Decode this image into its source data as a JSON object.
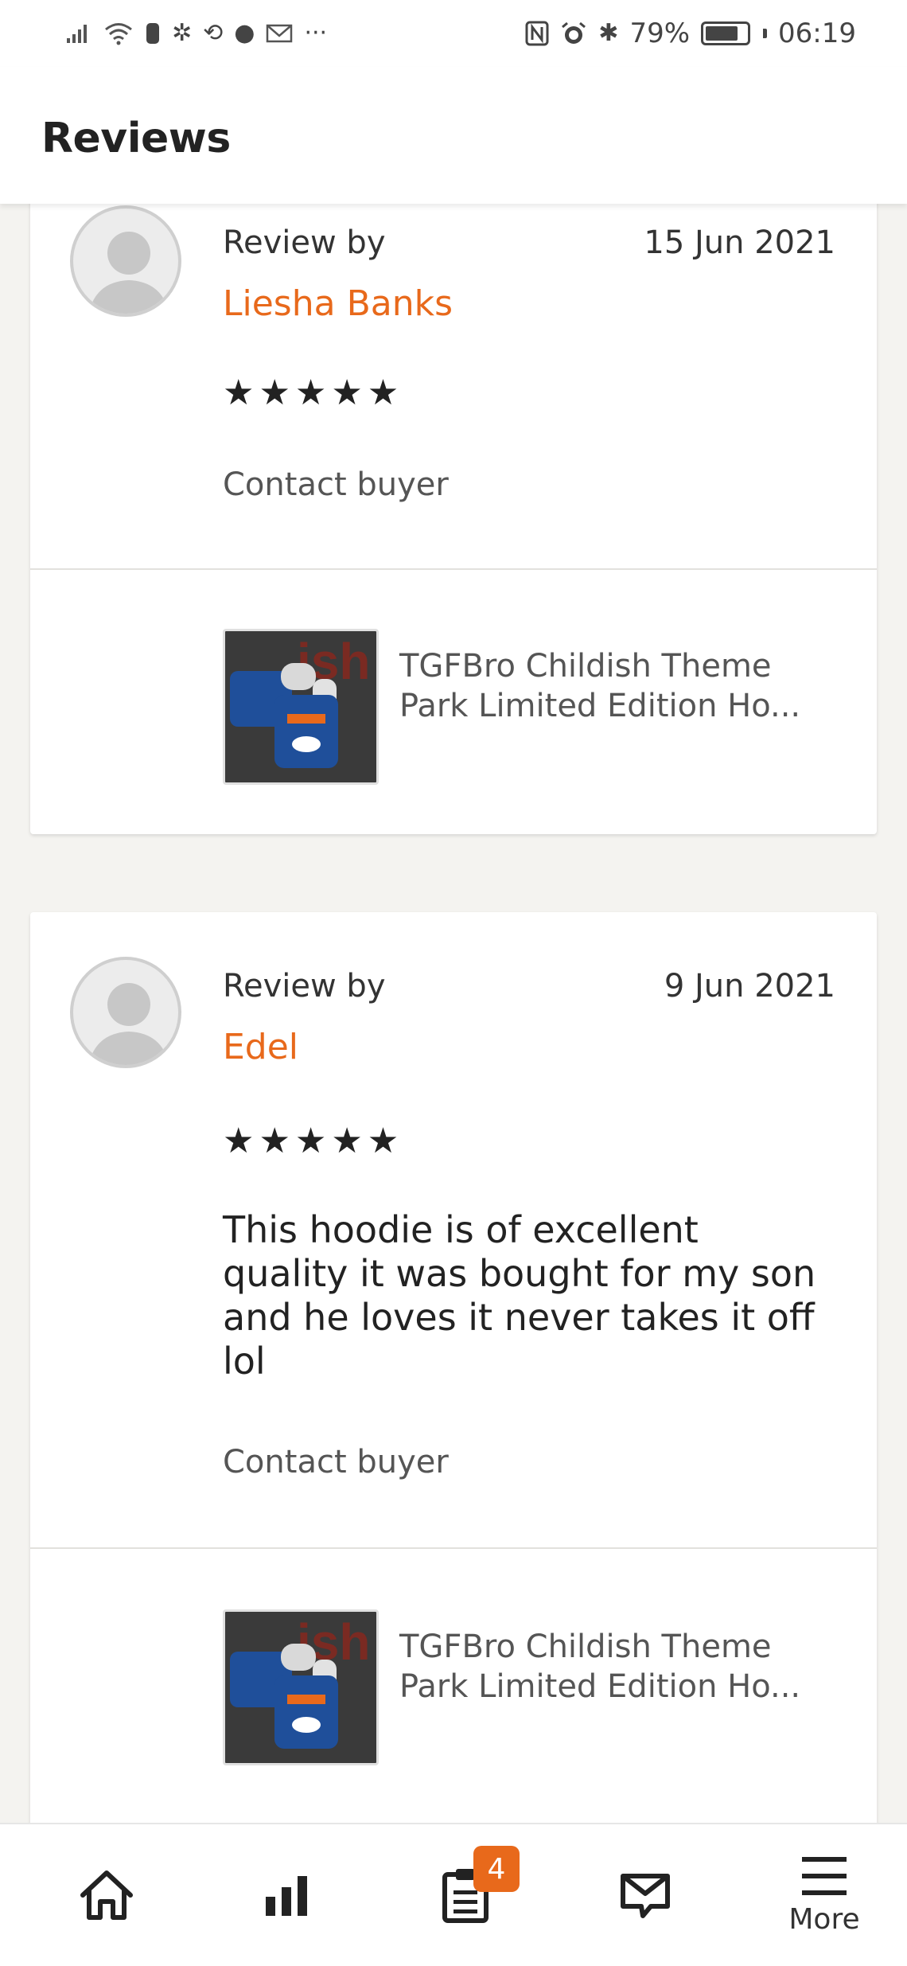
{
  "status_bar": {
    "battery_percent": "79%",
    "battery_level": 0.79,
    "time": "06:19",
    "left_icons": [
      "signal-icon",
      "wifi-icon",
      "notification-icon",
      "settings-icon",
      "sync-icon",
      "circle-icon",
      "mail-icon",
      "more-icon"
    ],
    "right_icons": [
      "nfc-icon",
      "alarm-icon",
      "bluetooth-icon"
    ]
  },
  "header": {
    "title": "Reviews"
  },
  "reviews": [
    {
      "review_by_label": "Review by",
      "reviewer": "Liesha Banks",
      "date": "15 Jun 2021",
      "stars": "★★★★★",
      "rating": 5,
      "text": "",
      "contact_label": "Contact buyer",
      "product_title": "TGFBro Childish Theme Park Limited Edition Ho..."
    },
    {
      "review_by_label": "Review by",
      "reviewer": "Edel",
      "date": "9 Jun 2021",
      "stars": "★★★★★",
      "rating": 5,
      "text": "This hoodie is of excellent quality it was bought for my son and he loves it never takes it off lol",
      "contact_label": "Contact buyer",
      "product_title": "TGFBro Childish Theme Park Limited Edition Ho..."
    }
  ],
  "bottom_nav": {
    "items": [
      {
        "name": "home",
        "icon": "home-icon",
        "label": ""
      },
      {
        "name": "stats",
        "icon": "stats-icon",
        "label": ""
      },
      {
        "name": "orders",
        "icon": "orders-icon",
        "label": "",
        "badge": "4"
      },
      {
        "name": "messages",
        "icon": "messages-icon",
        "label": ""
      },
      {
        "name": "more",
        "icon": "menu-icon",
        "label": "More"
      }
    ]
  },
  "colors": {
    "accent": "#e8691b",
    "background": "#f4f3f0",
    "card": "#ffffff"
  }
}
